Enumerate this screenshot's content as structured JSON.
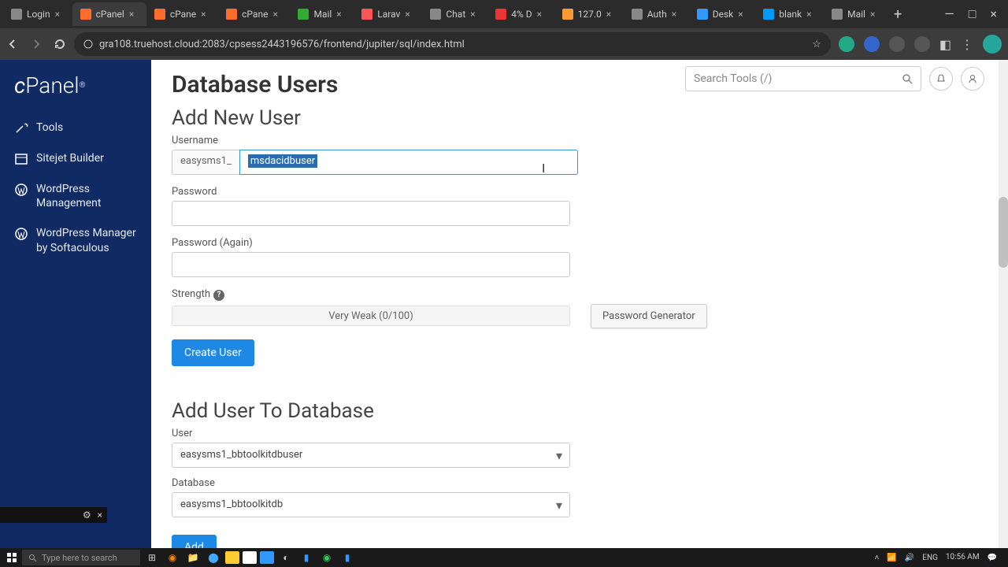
{
  "browser": {
    "tabs": [
      {
        "title": "Login"
      },
      {
        "title": "cPanel"
      },
      {
        "title": "cPane"
      },
      {
        "title": "cPane"
      },
      {
        "title": "Mail"
      },
      {
        "title": "Larav"
      },
      {
        "title": "Chat"
      },
      {
        "title": "4% D"
      },
      {
        "title": "127.0"
      },
      {
        "title": "Auth"
      },
      {
        "title": "Desk"
      },
      {
        "title": "blank"
      },
      {
        "title": "Mail"
      }
    ],
    "active_tab_index": 1,
    "url": "gra108.truehost.cloud:2083/cpsess2443196576/frontend/jupiter/sql/index.html"
  },
  "cpanel": {
    "logo": "cPanel",
    "search_placeholder": "Search Tools (/)",
    "nav": [
      {
        "label": "Tools"
      },
      {
        "label": "Sitejet Builder"
      },
      {
        "label": "WordPress Management"
      },
      {
        "label": "WordPress Manager by Softaculous"
      }
    ]
  },
  "page": {
    "title": "Database Users",
    "add_user": {
      "heading": "Add New User",
      "username_label": "Username",
      "username_prefix": "easysms1_",
      "username_value": "msdacidbuser",
      "password_label": "Password",
      "password_again_label": "Password (Again)",
      "strength_label": "Strength",
      "strength_text": "Very Weak (0/100)",
      "pw_gen_label": "Password Generator",
      "create_btn": "Create User"
    },
    "add_to_db": {
      "heading": "Add User To Database",
      "user_label": "User",
      "user_value": "easysms1_bbtoolkitdbuser",
      "db_label": "Database",
      "db_value": "easysms1_bbtoolkitdb",
      "add_btn": "Add"
    }
  },
  "taskbar": {
    "search_placeholder": "Type here to search",
    "time": "10:56 AM",
    "tray_text": "ENG"
  }
}
